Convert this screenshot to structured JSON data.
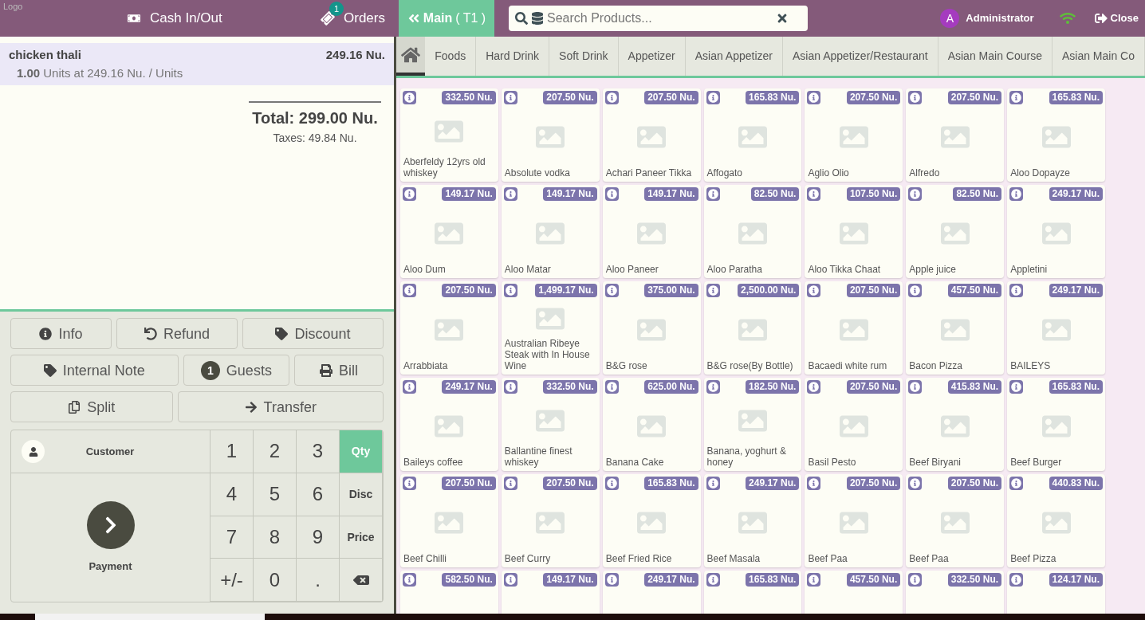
{
  "logo_alt": "Logo",
  "header": {
    "cash": "Cash In/Out",
    "orders": {
      "label": "Orders",
      "count": "1"
    },
    "floor": {
      "label": "Main",
      "table": "( T1 )"
    },
    "search": {
      "placeholder": "Search Products..."
    },
    "user": {
      "initial": "A",
      "name": "Administrator"
    },
    "close": "Close"
  },
  "order_lines": [
    {
      "name": "chicken thali",
      "price": "249.16 Nu.",
      "qty": "1.00",
      "detail": "Units at 249.16 Nu. / Units",
      "selected": true
    }
  ],
  "summary": {
    "total": "Total: 299.00 Nu.",
    "taxes": "Taxes: 49.84 Nu."
  },
  "control_rows": [
    [
      {
        "kind": "info",
        "label": "Info"
      },
      {
        "kind": "refund",
        "label": "Refund"
      },
      {
        "kind": "discount",
        "label": "Discount"
      }
    ],
    [
      {
        "kind": "note",
        "label": "Internal Note"
      },
      {
        "kind": "guests",
        "count": "1",
        "label": "Guests"
      },
      {
        "kind": "bill",
        "label": "Bill"
      }
    ],
    [
      {
        "kind": "split",
        "label": "Split"
      },
      {
        "kind": "transfer",
        "label": "Transfer"
      }
    ]
  ],
  "customer": "Customer",
  "payment": "Payment",
  "numpad": [
    {
      "kind": "digit",
      "label": "1"
    },
    {
      "kind": "digit",
      "label": "2"
    },
    {
      "kind": "digit",
      "label": "3"
    },
    {
      "kind": "mode",
      "label": "Qty",
      "selected": true
    },
    {
      "kind": "digit",
      "label": "4"
    },
    {
      "kind": "digit",
      "label": "5"
    },
    {
      "kind": "digit",
      "label": "6"
    },
    {
      "kind": "mode",
      "label": "Disc",
      "selected": false
    },
    {
      "kind": "digit",
      "label": "7"
    },
    {
      "kind": "digit",
      "label": "8"
    },
    {
      "kind": "digit",
      "label": "9"
    },
    {
      "kind": "mode",
      "label": "Price",
      "selected": false
    },
    {
      "kind": "digit",
      "label": "+/-"
    },
    {
      "kind": "digit",
      "label": "0"
    },
    {
      "kind": "digit",
      "label": "."
    },
    {
      "kind": "backspace"
    }
  ],
  "categories": [
    {
      "label": "Foods"
    },
    {
      "label": "Hard Drink"
    },
    {
      "label": "Soft Drink"
    },
    {
      "label": "Appetizer"
    },
    {
      "label": "Asian Appetizer"
    },
    {
      "label": "Asian Appetizer/Restaurant"
    },
    {
      "label": "Asian Main Course"
    },
    {
      "label": "Asian Main Co"
    }
  ],
  "products": [
    {
      "price": "332.50 Nu.",
      "name": "Aberfeldy 12yrs old whiskey"
    },
    {
      "price": "207.50 Nu.",
      "name": "Absolute vodka"
    },
    {
      "price": "207.50 Nu.",
      "name": "Achari Paneer Tikka"
    },
    {
      "price": "165.83 Nu.",
      "name": "Affogato"
    },
    {
      "price": "207.50 Nu.",
      "name": "Aglio Olio"
    },
    {
      "price": "207.50 Nu.",
      "name": "Alfredo"
    },
    {
      "price": "165.83 Nu.",
      "name": "Aloo Dopayze"
    },
    {
      "price": "149.17 Nu.",
      "name": "Aloo Dum"
    },
    {
      "price": "149.17 Nu.",
      "name": "Aloo Matar"
    },
    {
      "price": "149.17 Nu.",
      "name": "Aloo Paneer"
    },
    {
      "price": "82.50 Nu.",
      "name": "Aloo Paratha"
    },
    {
      "price": "107.50 Nu.",
      "name": "Aloo Tikka Chaat"
    },
    {
      "price": "82.50 Nu.",
      "name": "Apple juice"
    },
    {
      "price": "249.17 Nu.",
      "name": "Appletini"
    },
    {
      "price": "207.50 Nu.",
      "name": "Arrabbiata"
    },
    {
      "price": "1,499.17 Nu.",
      "name": "Australian Ribeye Steak with In House Wine"
    },
    {
      "price": "375.00 Nu.",
      "name": "B&G rose"
    },
    {
      "price": "2,500.00 Nu.",
      "name": "B&G rose(By Bottle)"
    },
    {
      "price": "207.50 Nu.",
      "name": "Bacaedi white rum"
    },
    {
      "price": "457.50 Nu.",
      "name": "Bacon Pizza"
    },
    {
      "price": "249.17 Nu.",
      "name": "BAILEYS"
    },
    {
      "price": "249.17 Nu.",
      "name": "Baileys coffee"
    },
    {
      "price": "332.50 Nu.",
      "name": "Ballantine finest whiskey"
    },
    {
      "price": "625.00 Nu.",
      "name": "Banana Cake"
    },
    {
      "price": "182.50 Nu.",
      "name": "Banana, yoghurt & honey"
    },
    {
      "price": "207.50 Nu.",
      "name": "Basil Pesto"
    },
    {
      "price": "415.83 Nu.",
      "name": "Beef Biryani"
    },
    {
      "price": "165.83 Nu.",
      "name": "Beef Burger"
    },
    {
      "price": "207.50 Nu.",
      "name": "Beef Chilli"
    },
    {
      "price": "207.50 Nu.",
      "name": "Beef Curry"
    },
    {
      "price": "165.83 Nu.",
      "name": "Beef Fried Rice"
    },
    {
      "price": "249.17 Nu.",
      "name": "Beef Masala"
    },
    {
      "price": "207.50 Nu.",
      "name": "Beef Paa"
    },
    {
      "price": "207.50 Nu.",
      "name": "Beef Paa"
    },
    {
      "price": "440.83 Nu.",
      "name": "Beef Pizza"
    },
    {
      "price": "582.50 Nu."
    },
    {
      "price": "149.17 Nu."
    },
    {
      "price": "249.17 Nu."
    },
    {
      "price": "165.83 Nu."
    },
    {
      "price": "457.50 Nu."
    },
    {
      "price": "332.50 Nu."
    },
    {
      "price": "124.17 Nu."
    }
  ]
}
